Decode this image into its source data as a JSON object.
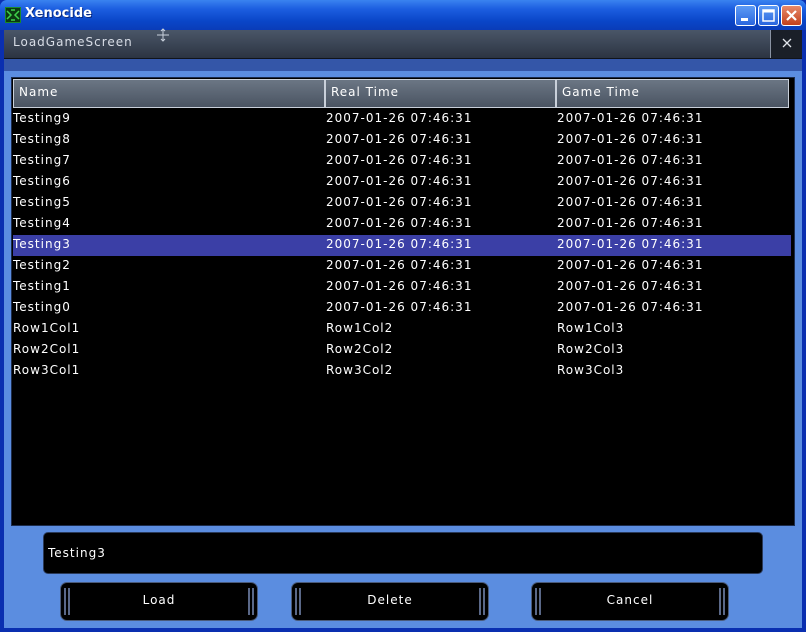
{
  "window": {
    "title": "Xenocide"
  },
  "screen": {
    "title": "LoadGameScreen"
  },
  "grid": {
    "columns": [
      "Name",
      "Real Time",
      "Game Time"
    ],
    "rows": [
      [
        "Testing9",
        "2007-01-26 07:46:31",
        "2007-01-26 07:46:31"
      ],
      [
        "Testing8",
        "2007-01-26 07:46:31",
        "2007-01-26 07:46:31"
      ],
      [
        "Testing7",
        "2007-01-26 07:46:31",
        "2007-01-26 07:46:31"
      ],
      [
        "Testing6",
        "2007-01-26 07:46:31",
        "2007-01-26 07:46:31"
      ],
      [
        "Testing5",
        "2007-01-26 07:46:31",
        "2007-01-26 07:46:31"
      ],
      [
        "Testing4",
        "2007-01-26 07:46:31",
        "2007-01-26 07:46:31"
      ],
      [
        "Testing3",
        "2007-01-26 07:46:31",
        "2007-01-26 07:46:31"
      ],
      [
        "Testing2",
        "2007-01-26 07:46:31",
        "2007-01-26 07:46:31"
      ],
      [
        "Testing1",
        "2007-01-26 07:46:31",
        "2007-01-26 07:46:31"
      ],
      [
        "Testing0",
        "2007-01-26 07:46:31",
        "2007-01-26 07:46:31"
      ],
      [
        "Row1Col1",
        "Row1Col2",
        "Row1Col3"
      ],
      [
        "Row2Col1",
        "Row2Col2",
        "Row2Col3"
      ],
      [
        "Row3Col1",
        "Row3Col2",
        "Row3Col3"
      ]
    ],
    "selected_index": 6
  },
  "filename_input": {
    "value": "Testing3"
  },
  "buttons": {
    "load": "Load",
    "delete": "Delete",
    "cancel": "Cancel"
  },
  "colors": {
    "selection": "#3b3fa6",
    "panel": "#5b8de0",
    "titlebar": "#0a46c8"
  }
}
